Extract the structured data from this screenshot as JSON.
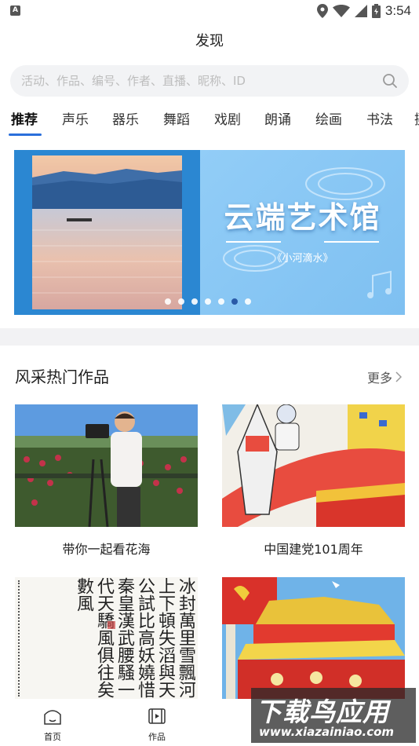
{
  "status_bar": {
    "time": "3:54",
    "left_icon_letter": "A"
  },
  "header": {
    "title": "发现"
  },
  "search": {
    "placeholder": "活动、作品、编号、作者、直播、昵称、ID"
  },
  "tabs": [
    {
      "label": "推荐",
      "active": true
    },
    {
      "label": "声乐"
    },
    {
      "label": "器乐"
    },
    {
      "label": "舞蹈"
    },
    {
      "label": "戏剧"
    },
    {
      "label": "朗诵"
    },
    {
      "label": "绘画"
    },
    {
      "label": "书法"
    },
    {
      "label": "摄"
    }
  ],
  "banner": {
    "title": "云端艺术馆",
    "subtitle": "《小河滴水》",
    "dot_count": 7,
    "active_dot": 6
  },
  "section": {
    "title": "风采热门作品",
    "more_label": "更多"
  },
  "works": [
    {
      "label": "带你一起看花海"
    },
    {
      "label": "中国建党101周年"
    },
    {
      "label": ""
    },
    {
      "label": ""
    }
  ],
  "calligraphy_text": "冰封萬里雪飄河上下頓失滔與天公試比高妖嬈惜秦皇漢武腰騷一代天驕風俱往矣數風",
  "bottom_nav": [
    {
      "label": "首页",
      "icon": "home-icon"
    },
    {
      "label": "作品",
      "icon": "film-icon"
    }
  ],
  "watermark": {
    "big": "下载鸟应用",
    "small": "www.xiazainiao.com"
  },
  "colors": {
    "accent": "#2a6fdb",
    "banner_blue": "#8ccaf5"
  }
}
